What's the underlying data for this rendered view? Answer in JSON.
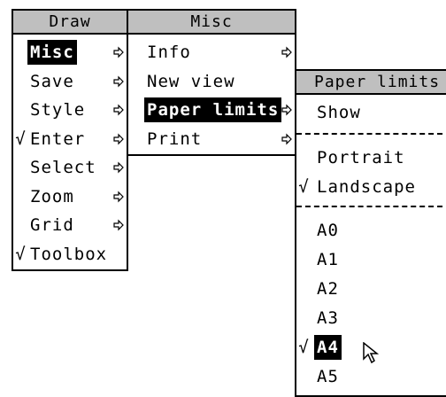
{
  "draw_menu": {
    "title": "Draw",
    "items": [
      {
        "label": "Misc",
        "tick": "",
        "arrow": true,
        "selected": true
      },
      {
        "label": "Save",
        "tick": "",
        "arrow": true,
        "selected": false
      },
      {
        "label": "Style",
        "tick": "",
        "arrow": true,
        "selected": false
      },
      {
        "label": "Enter",
        "tick": "√",
        "arrow": true,
        "selected": false
      },
      {
        "label": "Select",
        "tick": "",
        "arrow": true,
        "selected": false
      },
      {
        "label": "Zoom",
        "tick": "",
        "arrow": true,
        "selected": false
      },
      {
        "label": "Grid",
        "tick": "",
        "arrow": true,
        "selected": false
      },
      {
        "label": "Toolbox",
        "tick": "√",
        "arrow": false,
        "selected": false
      }
    ]
  },
  "misc_menu": {
    "title": "Misc",
    "items": [
      {
        "label": "Info",
        "tick": "",
        "arrow": true,
        "selected": false
      },
      {
        "label": "New view",
        "tick": "",
        "arrow": false,
        "selected": false
      },
      {
        "label": "Paper limits",
        "tick": "",
        "arrow": true,
        "selected": true
      },
      {
        "label": "Print",
        "tick": "",
        "arrow": true,
        "selected": false
      }
    ]
  },
  "paper_menu": {
    "title": "Paper limits",
    "show": {
      "label": "Show",
      "tick": ""
    },
    "orientation": [
      {
        "label": "Portrait",
        "tick": ""
      },
      {
        "label": "Landscape",
        "tick": "√"
      }
    ],
    "sizes": [
      {
        "label": "A0",
        "tick": "",
        "selected": false
      },
      {
        "label": "A1",
        "tick": "",
        "selected": false
      },
      {
        "label": "A2",
        "tick": "",
        "selected": false
      },
      {
        "label": "A3",
        "tick": "",
        "selected": false
      },
      {
        "label": "A4",
        "tick": "√",
        "selected": true
      },
      {
        "label": "A5",
        "tick": "",
        "selected": false
      }
    ]
  },
  "icons": {
    "submenu_arrow": "submenu-arrow-icon",
    "pointer": "mouse-pointer-icon"
  }
}
